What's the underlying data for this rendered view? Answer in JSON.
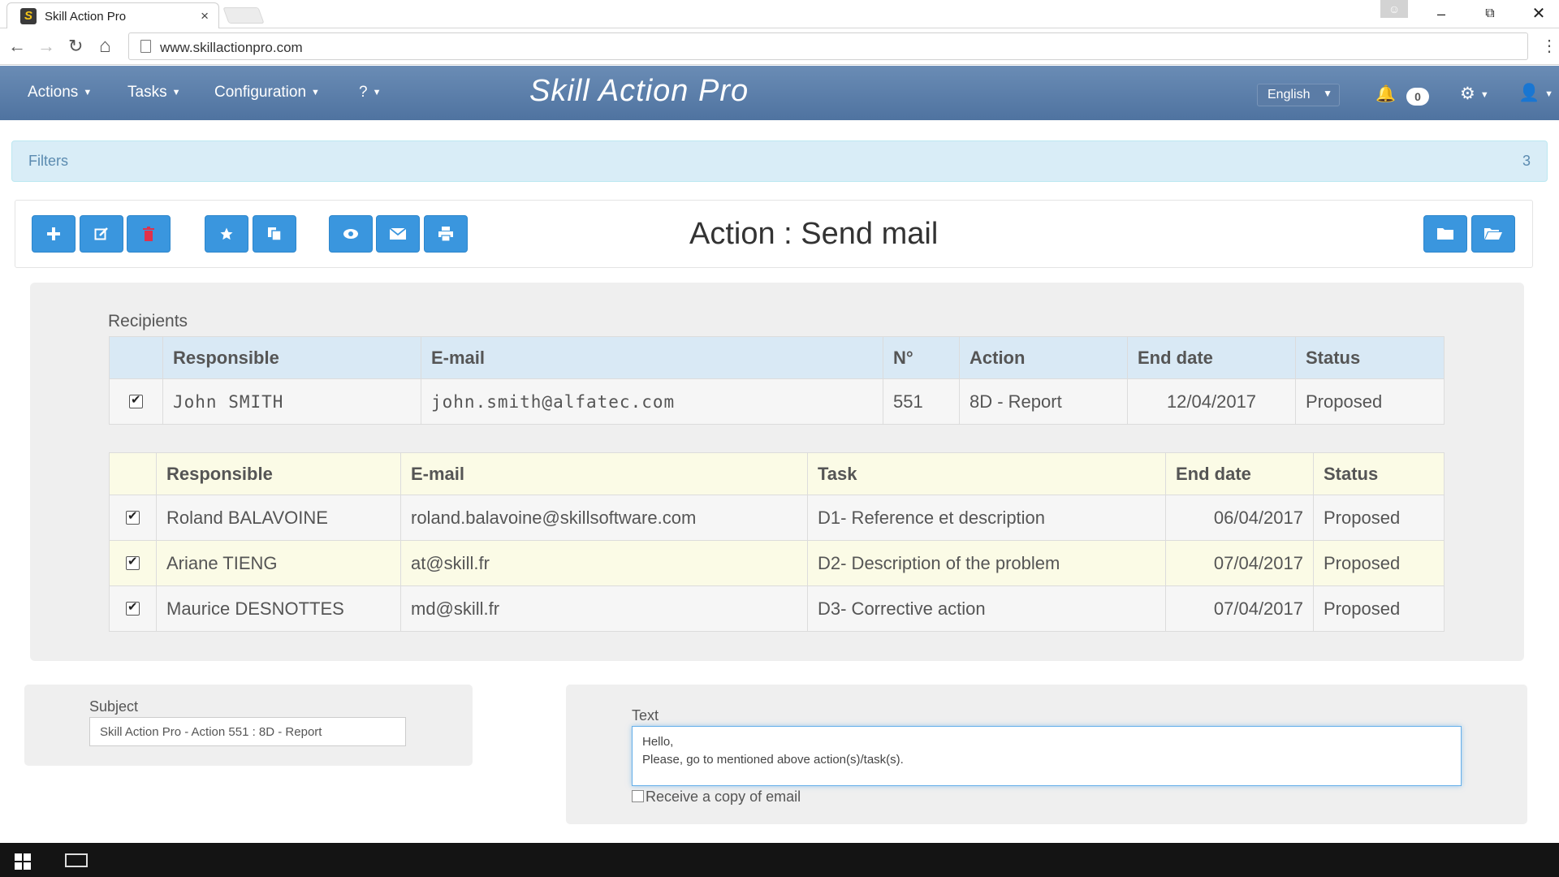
{
  "browser": {
    "tab_title": "Skill Action Pro",
    "tab_close": "×",
    "url": "www.skillactionpro.com"
  },
  "navbar": {
    "menus": [
      "Actions",
      "Tasks",
      "Configuration",
      "?"
    ],
    "brand": "Skill Action Pro",
    "language": "English",
    "notification_count": "0"
  },
  "filters": {
    "label": "Filters",
    "count": "3"
  },
  "toolbar": {
    "title": "Action : Send mail"
  },
  "recipients": {
    "label": "Recipients",
    "action_table": {
      "headers": [
        "Responsible",
        "E-mail",
        "N°",
        "Action",
        "End date",
        "Status"
      ],
      "rows": [
        {
          "responsible": "John SMITH",
          "email": "john.smith@alfatec.com",
          "number": "551",
          "action": "8D - Report",
          "end_date": "12/04/2017",
          "status": "Proposed",
          "checked": true
        }
      ]
    },
    "task_table": {
      "headers": [
        "Responsible",
        "E-mail",
        "Task",
        "End date",
        "Status"
      ],
      "rows": [
        {
          "responsible": "Roland BALAVOINE",
          "email": "roland.balavoine@skillsoftware.com",
          "task": "D1- Reference et description",
          "end_date": "06/04/2017",
          "status": "Proposed",
          "checked": true
        },
        {
          "responsible": "Ariane TIENG",
          "email": "at@skill.fr",
          "task": "D2- Description of the problem",
          "end_date": "07/04/2017",
          "status": "Proposed",
          "checked": true
        },
        {
          "responsible": "Maurice DESNOTTES",
          "email": "md@skill.fr",
          "task": "D3- Corrective action",
          "end_date": "07/04/2017",
          "status": "Proposed",
          "checked": true
        }
      ]
    }
  },
  "mail": {
    "subject_label": "Subject",
    "subject_value": "Skill Action Pro - Action 551 : 8D - Report",
    "text_label": "Text",
    "text_line1": "Hello,",
    "text_line2": "Please, go to mentioned above action(s)/task(s).",
    "copy_label": "Receive a copy of email"
  },
  "colors": {
    "navbar": "#5b7ea9",
    "button": "#3a96de",
    "filters_bg": "#d9edf7"
  }
}
